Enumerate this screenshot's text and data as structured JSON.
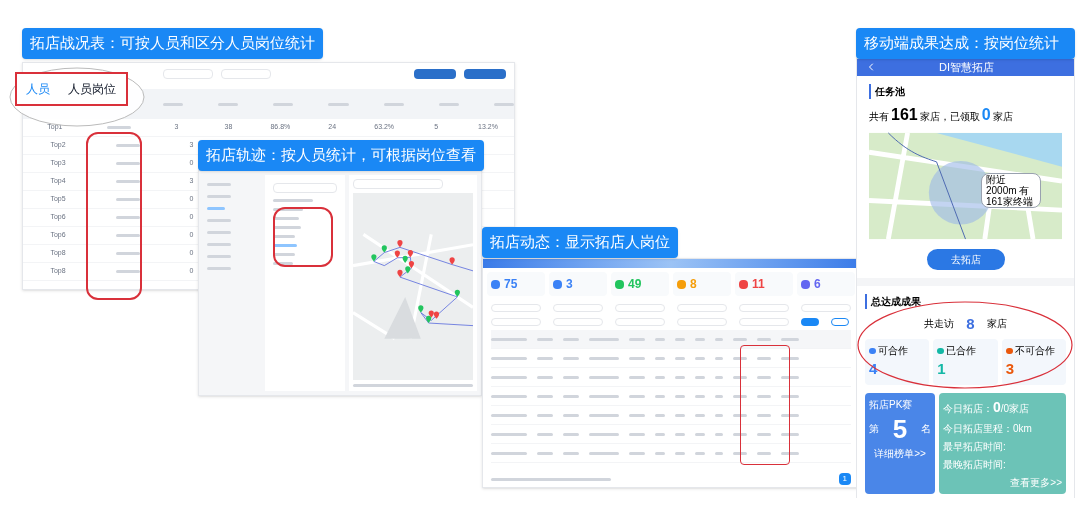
{
  "table_screen": {
    "banner": "拓店战况表：可按人员和区分人员岗位统计",
    "tabs": [
      {
        "label": "人员",
        "selected": true
      },
      {
        "label": "人员岗位",
        "selected": false
      }
    ],
    "rows": [
      {
        "rank": "Top1",
        "cells": [
          "3",
          "38",
          "86.8%",
          "24",
          "63.2%",
          "5",
          "13.2%"
        ]
      },
      {
        "rank": "Top2",
        "cells": [
          "3"
        ]
      },
      {
        "rank": "Top3",
        "cells": [
          "0"
        ]
      },
      {
        "rank": "Top4",
        "cells": [
          "3"
        ]
      },
      {
        "rank": "Top5",
        "cells": [
          "0"
        ]
      },
      {
        "rank": "Top6",
        "cells": [
          "0"
        ]
      },
      {
        "rank": "Top6",
        "cells": [
          "0"
        ]
      },
      {
        "rank": "Top8",
        "cells": [
          "0"
        ]
      },
      {
        "rank": "Top8",
        "cells": [
          "0"
        ]
      }
    ]
  },
  "track_screen": {
    "banner": "拓店轨迹：按人员统计，可根据岗位查看"
  },
  "dynamic_screen": {
    "banner": "拓店动态：显示拓店人岗位",
    "stats": [
      {
        "value": "75",
        "color": "#3b82f6"
      },
      {
        "value": "3",
        "color": "#3b82f6"
      },
      {
        "value": "49",
        "color": "#22c55e"
      },
      {
        "value": "8",
        "color": "#f59e0b"
      },
      {
        "value": "11",
        "color": "#ef4444"
      },
      {
        "value": "6",
        "color": "#6366f1"
      }
    ],
    "page": "1"
  },
  "mobile": {
    "banner": "移动端成果达成：按岗位统计",
    "title": "DI智慧拓店",
    "pool_title": "任务池",
    "pool_text": [
      "共有",
      "161",
      "家店，已领取",
      "0",
      "家店"
    ],
    "map_bubble": "附近2000m 有161家终端",
    "go_button": "去拓店",
    "result_title": "总达成成果",
    "visited": [
      "共走访",
      "8",
      "家店"
    ],
    "results": [
      {
        "label": "可合作",
        "value": "4",
        "color": "#3b82f6"
      },
      {
        "label": "已合作",
        "value": "1",
        "color": "#14b8a6"
      },
      {
        "label": "不可合作",
        "value": "3",
        "color": "#ea580c"
      }
    ],
    "pk": {
      "title": "拓店PK赛",
      "prefix": "第",
      "rank": "5",
      "suffix": "名",
      "link": "详细榜单>>"
    },
    "today": {
      "label": "今日拓店：",
      "count": "0",
      "total": "/0家店",
      "lines": [
        "今日拓店里程：0km",
        "最早拓店时间:",
        "最晚拓店时间:"
      ],
      "link": "查看更多>>"
    }
  }
}
